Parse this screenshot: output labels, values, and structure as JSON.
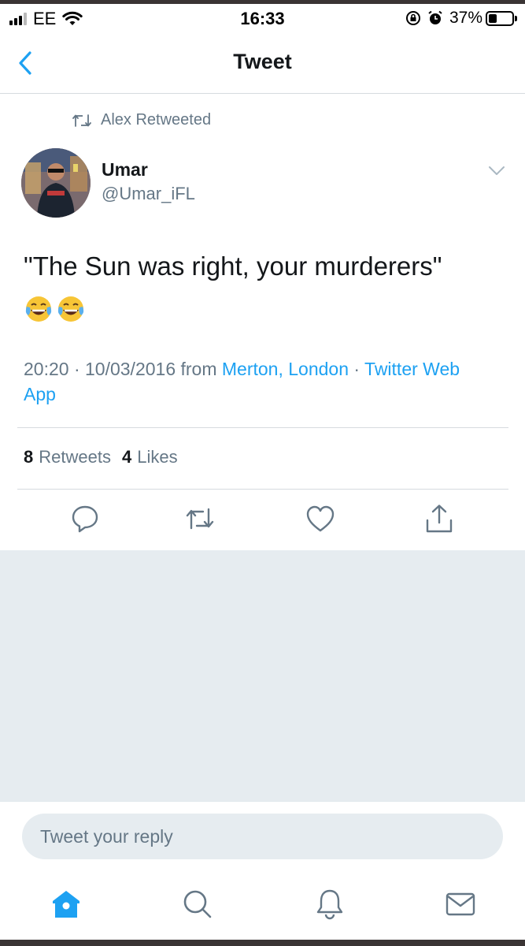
{
  "status_bar": {
    "carrier": "EE",
    "time": "16:33",
    "battery_percent": "37%",
    "battery_level": 0.37,
    "icons": [
      "signal-icon",
      "wifi-icon",
      "orientation-lock-icon",
      "alarm-icon",
      "battery-icon"
    ]
  },
  "nav": {
    "title": "Tweet",
    "back_icon": "chevron-left-icon"
  },
  "tweet": {
    "social_context": "Alex Retweeted",
    "author_name": "Umar",
    "author_handle": "@Umar_iFL",
    "text": "\"The Sun was right, your murderers\"",
    "emojis": [
      "face-with-tears-of-joy",
      "face-with-tears-of-joy"
    ],
    "timestamp": "20:20 · 10/03/2016",
    "from_label": "from",
    "location": "Merton, London",
    "separator": " · ",
    "source": "Twitter Web App",
    "retweet_count": "8",
    "retweet_label": "Retweets",
    "like_count": "4",
    "like_label": "Likes"
  },
  "actions": [
    "reply-icon",
    "retweet-icon",
    "like-icon",
    "share-icon"
  ],
  "reply": {
    "placeholder": "Tweet your reply"
  },
  "tabbar": [
    "home-icon",
    "search-icon",
    "notifications-icon",
    "messages-icon"
  ],
  "colors": {
    "accent": "#1da1f2",
    "secondary_text": "#657786",
    "background_gray": "#e6ecf0"
  }
}
